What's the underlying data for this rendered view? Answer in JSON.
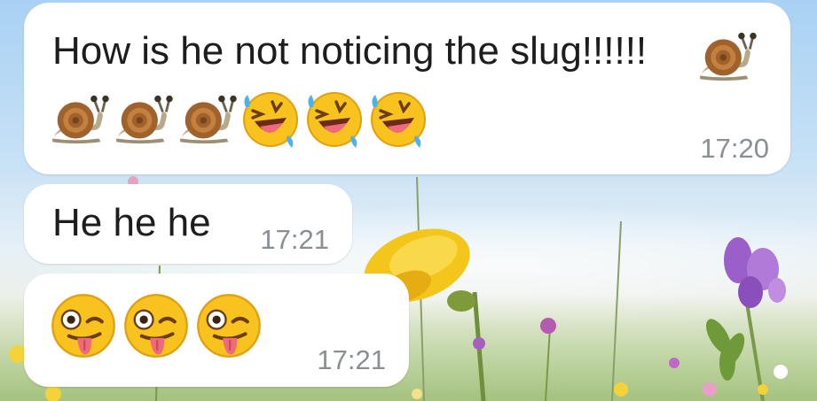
{
  "messages": [
    {
      "text": "How is he not noticing the slug!!!!!!",
      "emojis_line1": [
        "snail"
      ],
      "emojis_line2": [
        "snail",
        "snail",
        "snail",
        "rolling-on-floor-laughing",
        "rolling-on-floor-laughing",
        "rolling-on-floor-laughing"
      ],
      "time": "17:20"
    },
    {
      "text": "He he he",
      "time": "17:21"
    },
    {
      "emojis": [
        "winking-face-with-tongue",
        "winking-face-with-tongue",
        "winking-face-with-tongue"
      ],
      "time": "17:21"
    }
  ],
  "colors": {
    "bubble": "#ffffff",
    "text": "#1d1d1d",
    "time": "#8a8f94"
  }
}
